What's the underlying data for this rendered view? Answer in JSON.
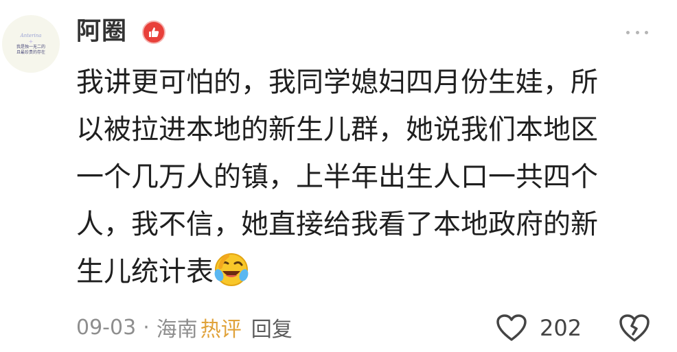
{
  "comment": {
    "avatar": {
      "line1": "Anterina",
      "line2": "我是独一无二的",
      "line3": "且最珍贵的存在"
    },
    "username": "阿圈",
    "badge_icon": "thumbs-up-icon",
    "more_icon": "more-dots-icon",
    "body_lines": [
      "我讲更可怕的，我同学媳妇四月份生娃，所",
      "以被拉进本地的新生儿群，她说我们本地区",
      "一个几万人的镇，上半年出生人口一共四个",
      "人，我不信，她直接给我看了本地政府的新",
      "生儿统计表"
    ],
    "emoji_icon": "laughing-crying-emoji",
    "date": "09-03",
    "separator": "·",
    "location": "海南",
    "hot_label": "热评",
    "reply_label": "回复",
    "like_icon": "heart-icon",
    "like_count": "202",
    "dislike_icon": "broken-heart-icon",
    "colors": {
      "hot": "#e0a23a",
      "badge": "#e8403a",
      "text": "#1f1f1f",
      "meta": "#8e8e8e"
    }
  }
}
